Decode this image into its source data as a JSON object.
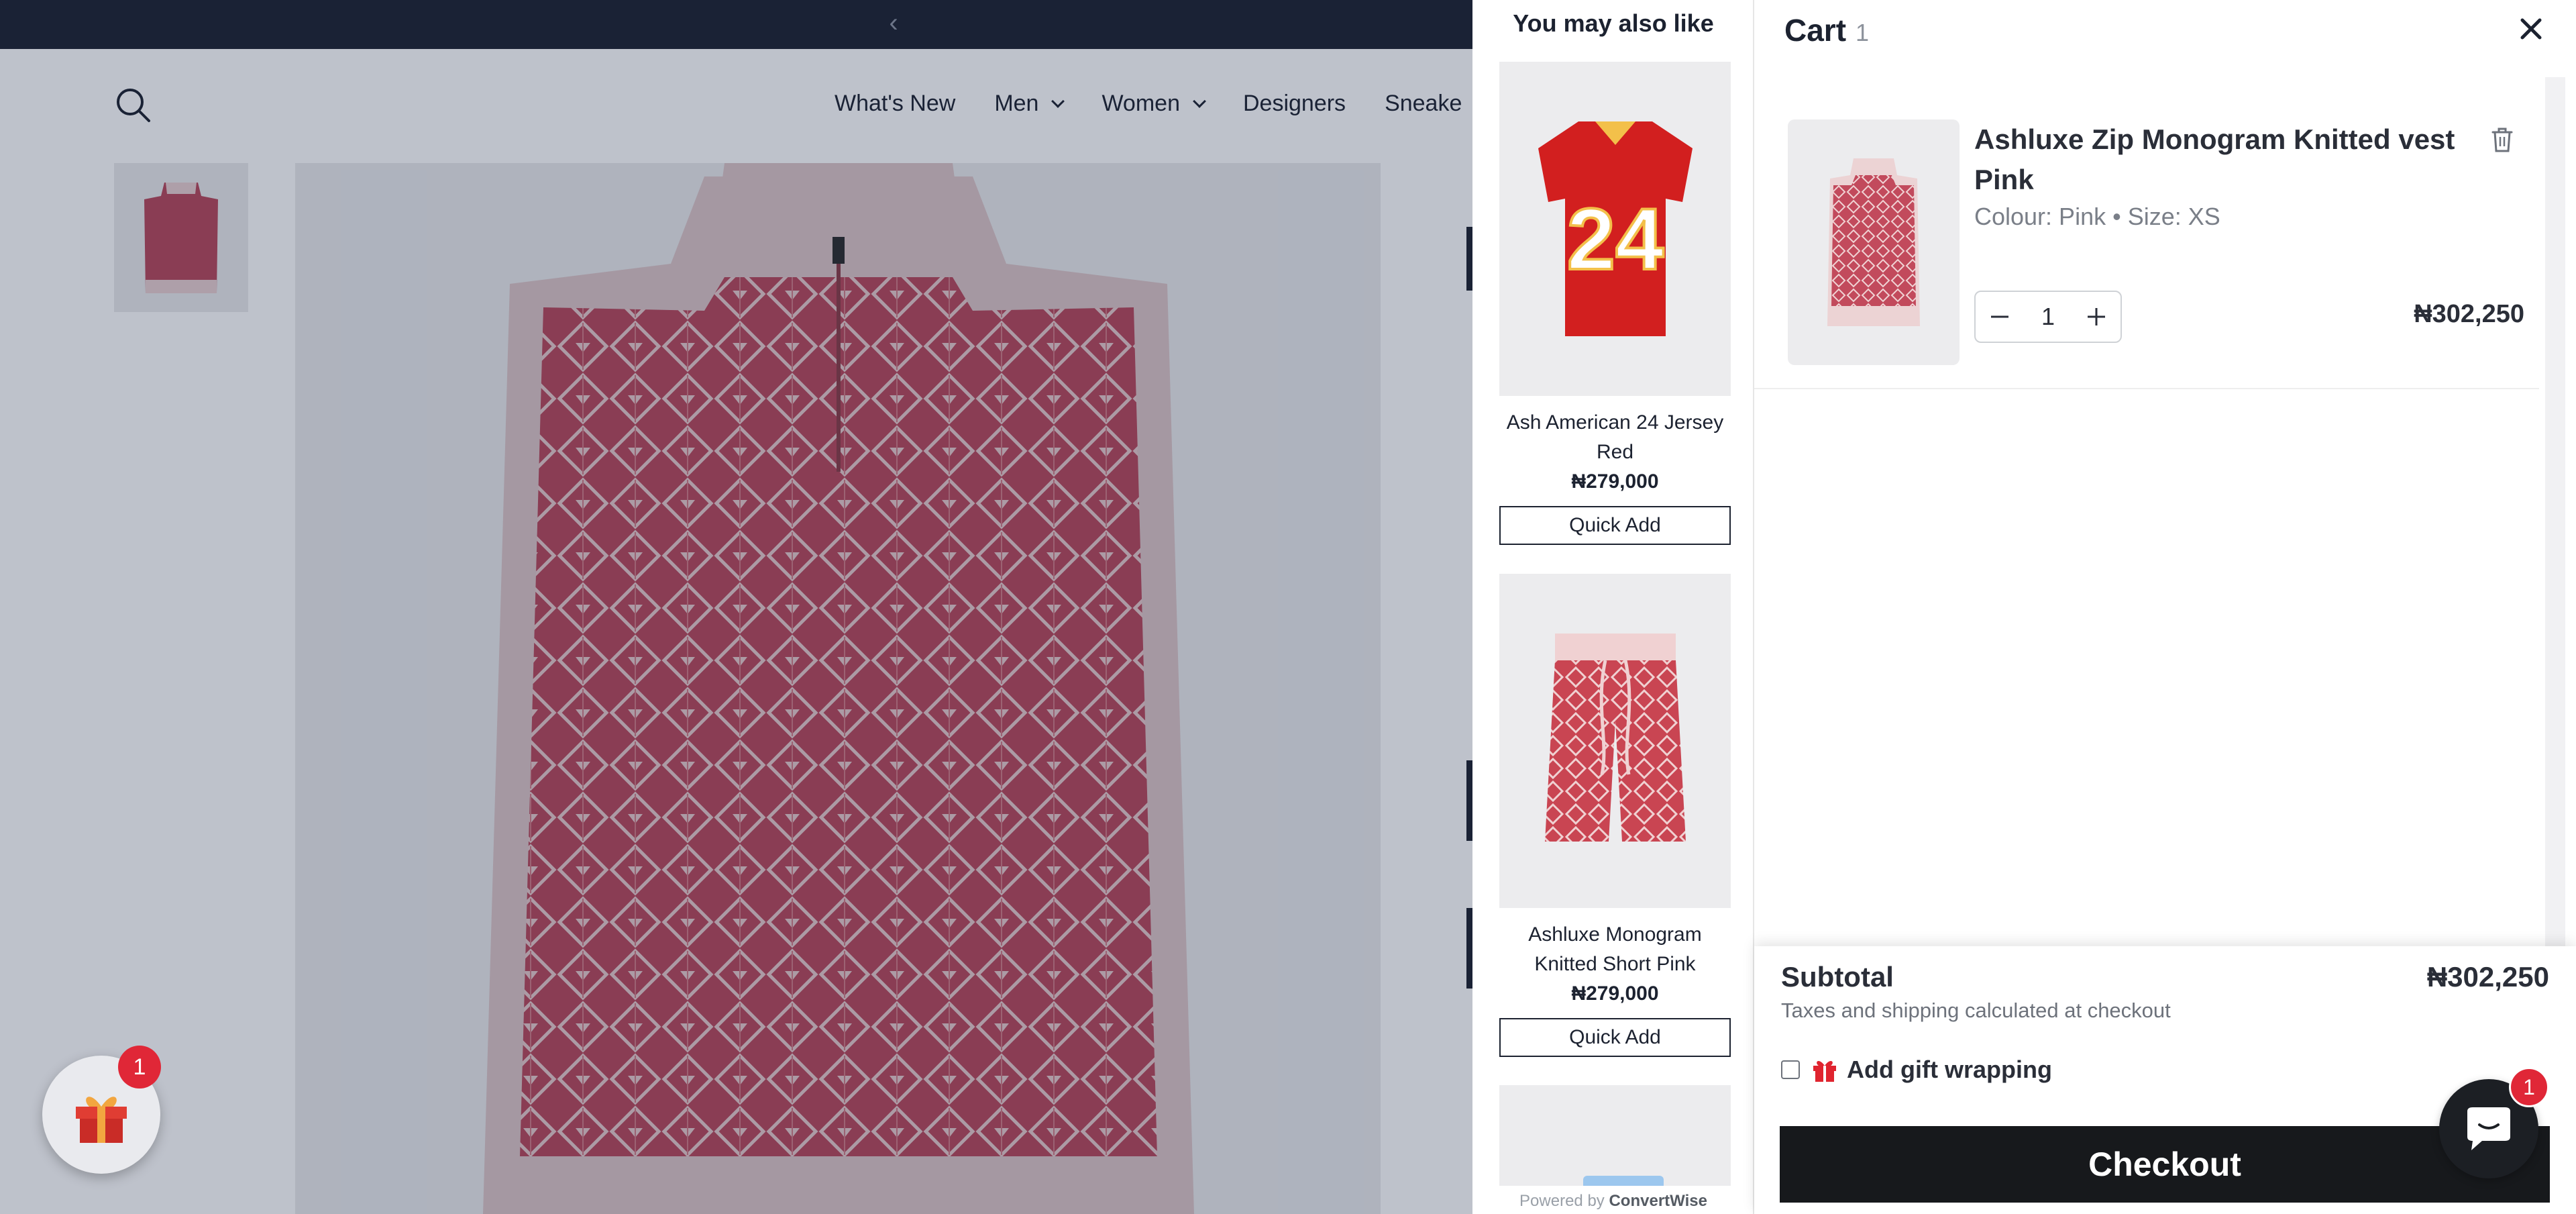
{
  "announcement": {
    "prev_icon": "chevron-left-icon"
  },
  "header": {
    "search_icon": "search-icon",
    "nav": [
      {
        "label": "What's New",
        "dropdown": false
      },
      {
        "label": "Men",
        "dropdown": true
      },
      {
        "label": "Women",
        "dropdown": true
      },
      {
        "label": "Designers",
        "dropdown": false
      },
      {
        "label": "Sneake",
        "dropdown": false
      }
    ]
  },
  "gift_widget": {
    "icon": "gift-icon",
    "badge": "1"
  },
  "recommendations": {
    "title": "You may also like",
    "items": [
      {
        "name": "Ash American 24 Jersey Red",
        "price": "₦279,000",
        "button": "Quick Add"
      },
      {
        "name": "Ashluxe Monogram Knitted Short Pink",
        "price": "₦279,000",
        "button": "Quick Add"
      }
    ],
    "powered_prefix": "Powered by",
    "powered_brand": "ConvertWise"
  },
  "cart": {
    "title": "Cart",
    "count": "1",
    "close_icon": "close-icon",
    "items": [
      {
        "name": "Ashluxe Zip Monogram Knitted vest Pink",
        "variant": "Colour: Pink • Size: XS",
        "quantity": "1",
        "price": "₦302,250"
      }
    ],
    "subtotal_label": "Subtotal",
    "subtotal_value": "₦302,250",
    "tax_note": "Taxes and shipping calculated at checkout",
    "gift_wrap_label": "Add gift wrapping",
    "gift_wrap_checked": false,
    "checkout_label": "Checkout"
  },
  "chat": {
    "icon": "chat-icon",
    "badge": "1"
  },
  "colors": {
    "announcement_bg": "#1c2230",
    "accent_red": "#e02737",
    "checkout_bg": "#17191c",
    "vest_pink": "#b8475a"
  }
}
